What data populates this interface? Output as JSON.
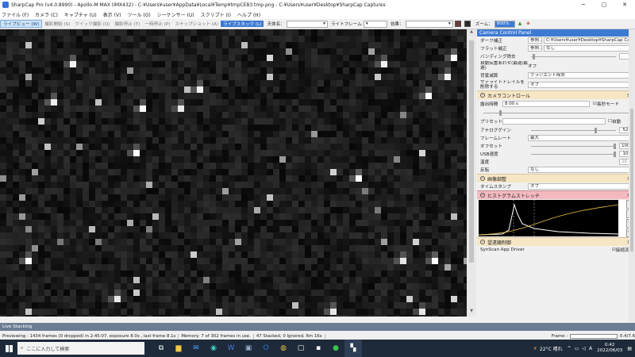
{
  "window": {
    "title": "SharpCap Pro (v4.0.8990) - Apollo-M MAX (IMX432) - C:¥Users¥user¥AppData¥Local¥Temp¥tmpCE83.tmp.png - C:¥Users¥user¥Desktop¥SharpCap Captures",
    "minimize": "─",
    "maximize": "▢",
    "close": "✕"
  },
  "menu": [
    "ファイル (F)",
    "カメラ (C)",
    "キャプチャ (U)",
    "表示 (V)",
    "ツール (O)",
    "シーケンサー (U)",
    "スクリプト (I)",
    "ヘルプ (H)"
  ],
  "toolbar": {
    "live_view": "ライブビュー (W)",
    "start_capture": "撮影開始 (S)",
    "quick_capture": "クイック撮影 (Q)",
    "stop_capture": "撮影停止 (T)",
    "pause": "一時停止 (P)",
    "snapshot": "スナップショット (A)",
    "live_stack": "ライブスタック (L)",
    "target_label": "天体名：",
    "target_value": "",
    "frame_label": "ライトフレーム",
    "effect_label": "効果：",
    "effect_value": "",
    "zoom_label": "ズーム：",
    "zoom_value": "800%"
  },
  "panel": {
    "header": "Camera Control Panel",
    "dark_label": "ダーク補正",
    "dark_button": "参照...",
    "dark_value": "C:¥Users¥user¥Desktop¥SharpCap Capt...",
    "flat_label": "フラット補正",
    "flat_button": "参照...",
    "flat_value": "なし",
    "banding_label": "バンディング除去",
    "banding_value": "0",
    "auto_stretch_label": "自動伝置あわせ(最適/最遅)",
    "auto_stretch_value": "オフ",
    "bg_label": "背景减算",
    "bg_value": "グラジエント除去",
    "satellite_label": "サテライトトレイルを削除する",
    "satellite_value": "オフ",
    "camera_section": "カメラコントロール",
    "exposure_label": "露出時間",
    "exposure_value": "8.00 s",
    "long_exposure_label": "長秒モード",
    "preset_label": "プリセット",
    "auto_label": "自動",
    "gain_label": "アナログゲイン",
    "gain_value": "525",
    "framerate_label": "フレームレート",
    "framerate_value": "最大",
    "offset_label": "オフセット",
    "offset_value": "1000",
    "usb_label": "USB速度",
    "usb_value": "100",
    "temp_label": "温度",
    "temp_value": "26.0",
    "flip_label": "反転",
    "flip_value": "なし",
    "image_section": "画像調整",
    "timestamp_label": "タイムスタンプ",
    "timestamp_value": "オフ",
    "histogram_section": "ヒストグラムストレッチ",
    "mount_section": "望遠鏡制御",
    "mount_driver": "SynScan App Driver",
    "mount_connected": "接続済み"
  },
  "bottom": {
    "tab": "Live Stacking",
    "status_preview": "Previewing : 1434 frames (0 dropped) in 2:45:07, exposure 8.0s , last frame 8.1s",
    "status_memory": "Memory: 7 of 302 frames in use.",
    "status_stack": "47 Stacked, 0 Ignored, 6m 16s",
    "frame_label": "Frame :",
    "frame_value": "0.4/7.6"
  },
  "taskbar": {
    "search_placeholder": "ここに入力して検索",
    "weather": "22°C 晴れ",
    "time": "0:42",
    "date": "2022/06/03"
  }
}
